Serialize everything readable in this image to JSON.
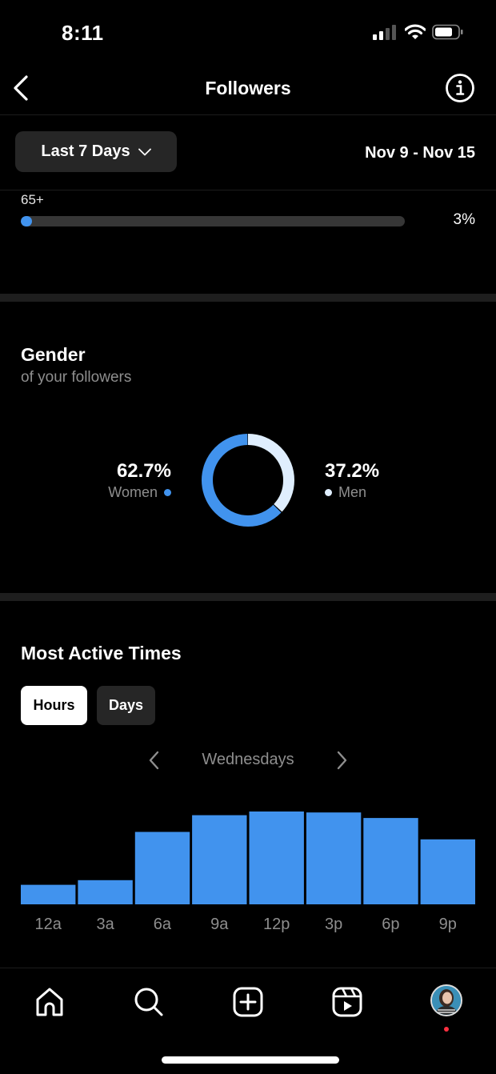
{
  "status_bar": {
    "time": "8:11",
    "signal_bars": 2,
    "battery_level": 0.7
  },
  "header": {
    "title": "Followers",
    "back_icon": "chevron-left-icon",
    "info_icon": "info-icon"
  },
  "filter": {
    "range_label": "Last 7 Days",
    "date_range": "Nov 9 - Nov 15"
  },
  "age": {
    "label": "65+",
    "percent_text": "3%",
    "percent": 3
  },
  "gender": {
    "title": "Gender",
    "subtitle": "of your followers",
    "women": {
      "value": "62.7%",
      "label": "Women",
      "percent": 62.7
    },
    "men": {
      "value": "37.2%",
      "label": "Men",
      "percent": 37.2
    },
    "colors": {
      "women": "#4193ee",
      "men": "#dfeefe"
    }
  },
  "active_times": {
    "title": "Most Active Times",
    "toggle": {
      "hours": "Hours",
      "days": "Days",
      "selected": "Hours"
    },
    "day_label": "Wednesdays"
  },
  "chart_data": {
    "type": "bar",
    "title": "Most Active Times — Wednesdays",
    "categories": [
      "12a",
      "3a",
      "6a",
      "9a",
      "12p",
      "3p",
      "6p",
      "9p"
    ],
    "values": [
      21,
      26,
      78,
      96,
      100,
      99,
      93,
      70
    ],
    "ylim": [
      0,
      100
    ],
    "xlabel": "",
    "ylabel": "",
    "color": "#4193ee"
  },
  "tabbar": {
    "items": [
      {
        "name": "home",
        "icon": "home-icon"
      },
      {
        "name": "search",
        "icon": "search-icon"
      },
      {
        "name": "create",
        "icon": "plus-square-icon"
      },
      {
        "name": "reels",
        "icon": "reels-icon"
      },
      {
        "name": "profile",
        "icon": "avatar"
      }
    ]
  }
}
